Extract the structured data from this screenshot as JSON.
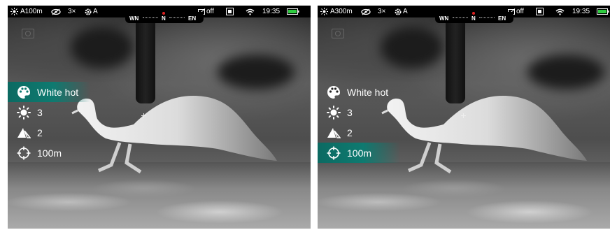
{
  "screens": [
    {
      "status": {
        "range_value": "A100m",
        "zoom": "3×",
        "mode": "A",
        "wifi_state": "off",
        "time": "19:35",
        "compass": {
          "left": "WN",
          "center": "N",
          "right": "EN"
        }
      },
      "menu": [
        {
          "icon": "palette-icon",
          "label": "White hot",
          "selected": true
        },
        {
          "icon": "brightness-icon",
          "label": "3",
          "selected": false
        },
        {
          "icon": "contrast-icon",
          "label": "2",
          "selected": false
        },
        {
          "icon": "rangefinder-target-icon",
          "label": "100m",
          "selected": false
        }
      ]
    },
    {
      "status": {
        "range_value": "A300m",
        "zoom": "3×",
        "mode": "A",
        "wifi_state": "off",
        "time": "19:35",
        "compass": {
          "left": "WN",
          "center": "N",
          "right": "EN"
        }
      },
      "menu": [
        {
          "icon": "palette-icon",
          "label": "White hot",
          "selected": false
        },
        {
          "icon": "brightness-icon",
          "label": "3",
          "selected": false
        },
        {
          "icon": "contrast-icon",
          "label": "2",
          "selected": false
        },
        {
          "icon": "rangefinder-target-icon",
          "label": "100m",
          "selected": true
        }
      ]
    }
  ],
  "colors": {
    "accent": "#0e7a70",
    "battery": "#2ecc40",
    "compass_marker": "#e02020"
  }
}
